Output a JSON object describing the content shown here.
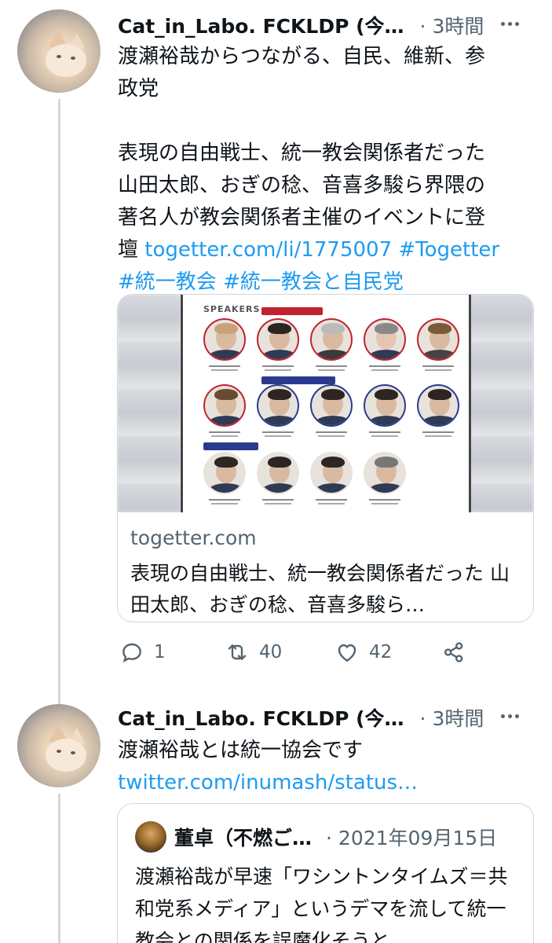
{
  "tweet1": {
    "author": "Cat_in_Labo. FCKLDP (今…",
    "time": "· 3時間",
    "text_line1": "渡瀬裕哉からつながる、自民、維新、参",
    "text_line2": "政党",
    "text_line3": "表現の自由戦士、統一教会関係者だった",
    "text_line4": "山田太郎、おぎの稔、音喜多駿ら界隈の",
    "text_line5": "著名人が教会関係者主催のイベントに登",
    "text_line6_prefix": "壇",
    "link_url": "togetter.com/li/1775007",
    "hashtag1": "#Togetter",
    "hashtag2": "#統一教会",
    "hashtag3": "#統一教会と自民党",
    "card": {
      "flyer_heading": "SPEAKERS",
      "domain": "togetter.com",
      "title": "表現の自由戦士、統一教会関係者だった 山田太郎、おぎの稔、音喜多駿ら…"
    },
    "actions": {
      "replies": "1",
      "retweets": "40",
      "likes": "42"
    }
  },
  "tweet2": {
    "author": "Cat_in_Labo. FCKLDP (今…",
    "time": "· 3時間",
    "text_line1": "渡瀬裕哉とは統一協会です",
    "link": "twitter.com/inumash/status…",
    "quote": {
      "author": "董卓（不燃ご…",
      "date": "· 2021年09月15日",
      "text": "渡瀬裕哉が早速「ワシントンタイムズ＝共和党系メディア」というデマを流して統一教会との関係を誤魔化そうと"
    }
  }
}
